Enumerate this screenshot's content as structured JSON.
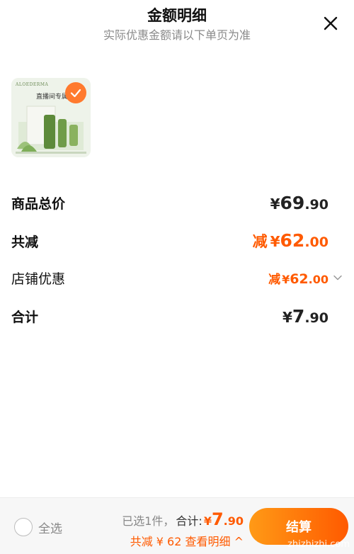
{
  "header": {
    "title": "金额明细",
    "subtitle": "实际优惠金额请以下单页为准",
    "close_icon": "close-icon"
  },
  "product": {
    "brand": "ALOEDERMA",
    "tag": "直播间专属",
    "selected": true,
    "check_icon": "check-icon"
  },
  "breakdown": {
    "goods_total": {
      "label": "商品总价",
      "yen": "¥",
      "int": "69",
      "dec": ".90"
    },
    "total_discount": {
      "label": "共减",
      "prefix": "减",
      "yen": "¥",
      "int": "62",
      "dec": ".00"
    },
    "store_discount": {
      "label": "店铺优惠",
      "prefix": "减",
      "yen": "¥",
      "int": "62",
      "dec": ".00",
      "icon": "chevron-down-icon"
    },
    "subtotal": {
      "label": "合计",
      "yen": "¥",
      "int": "7",
      "dec": ".90"
    }
  },
  "footer": {
    "select_all": "全选",
    "selected_count": "已选1件，",
    "total_label": "合计:",
    "total_yen": "¥",
    "total_int": "7",
    "total_dec": ".90",
    "discount_detail": "共减 ¥ 62  查看明细 ^",
    "checkout": "结算",
    "watermark": "zhizhizhi.com"
  },
  "colors": {
    "accent": "#ff5a00",
    "accent_light": "#ff9a16",
    "muted": "#8a8a8a"
  }
}
